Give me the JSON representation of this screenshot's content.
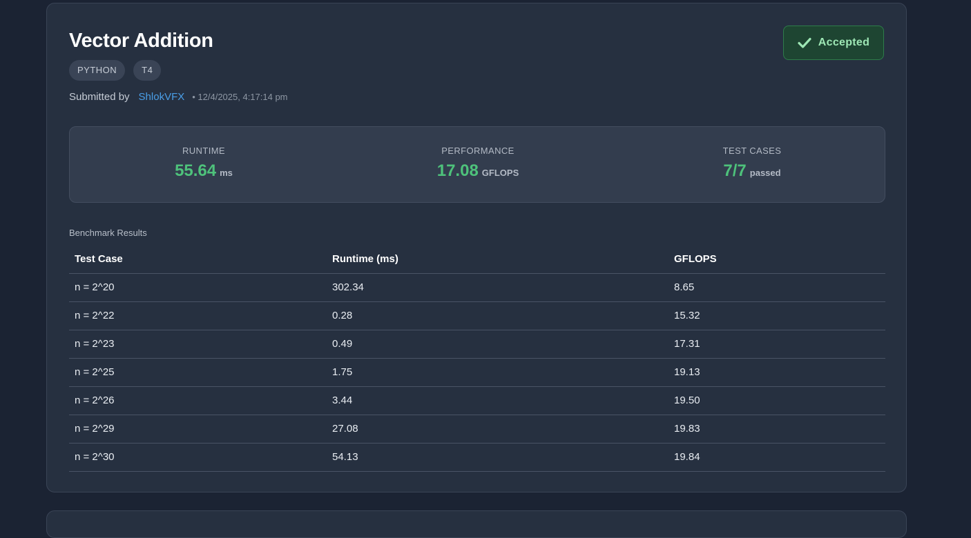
{
  "submission": {
    "title": "Vector Addition",
    "tags": [
      "PYTHON",
      "T4"
    ],
    "submitted_by_label": "Submitted by",
    "author": "ShlokVFX",
    "timestamp": "• 12/4/2025, 4:17:14 pm",
    "status": "Accepted"
  },
  "stats": {
    "runtime": {
      "label": "RUNTIME",
      "value": "55.64",
      "unit": "ms"
    },
    "performance": {
      "label": "PERFORMANCE",
      "value": "17.08",
      "unit": "GFLOPS"
    },
    "test_cases": {
      "label": "TEST CASES",
      "value": "7/7",
      "unit": "passed"
    }
  },
  "benchmark": {
    "label": "Benchmark Results",
    "headers": [
      "Test Case",
      "Runtime (ms)",
      "GFLOPS"
    ],
    "rows": [
      [
        "n = 2^20",
        "302.34",
        "8.65"
      ],
      [
        "n = 2^22",
        "0.28",
        "15.32"
      ],
      [
        "n = 2^23",
        "0.49",
        "17.31"
      ],
      [
        "n = 2^25",
        "1.75",
        "19.13"
      ],
      [
        "n = 2^26",
        "3.44",
        "19.50"
      ],
      [
        "n = 2^29",
        "27.08",
        "19.83"
      ],
      [
        "n = 2^30",
        "54.13",
        "19.84"
      ]
    ]
  },
  "colors": {
    "background": "#1b2333",
    "card": "#263040",
    "accent_green": "#4ec27b",
    "link_blue": "#4a9fe8",
    "badge_bg": "#1e4532"
  },
  "icons": {
    "status": "check-icon"
  }
}
